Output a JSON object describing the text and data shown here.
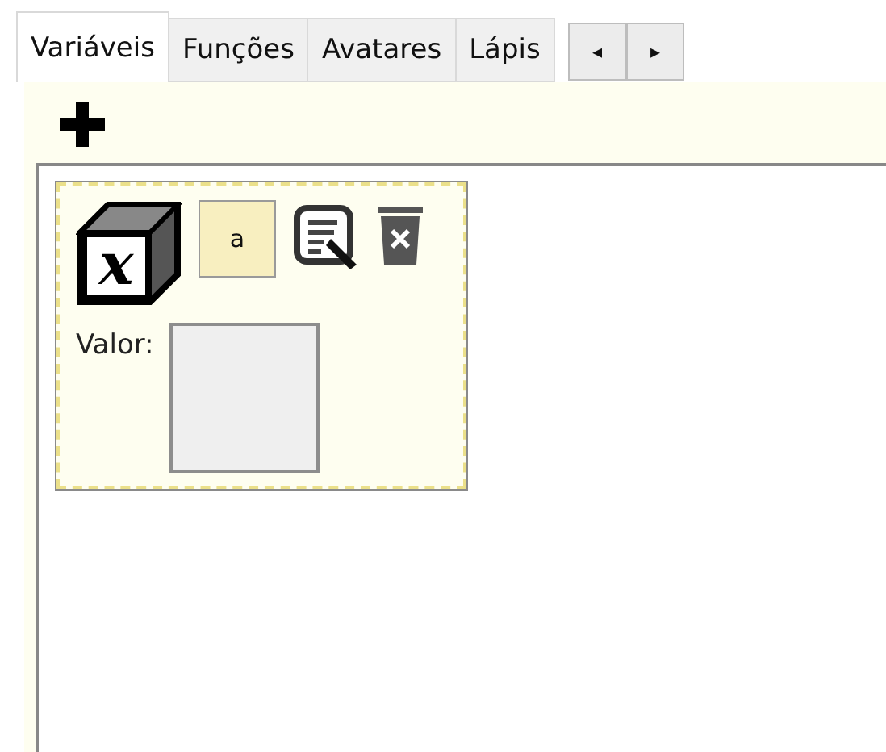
{
  "tabs": [
    {
      "label": "Variáveis",
      "selected": true
    },
    {
      "label": "Funções",
      "selected": false
    },
    {
      "label": "Avatares",
      "selected": false
    },
    {
      "label": "Lápis",
      "selected": false
    }
  ],
  "tab_scroll": {
    "left": "◂",
    "right": "▸"
  },
  "variables": [
    {
      "symbol": "x",
      "name": "a",
      "value_label": "Valor:"
    }
  ]
}
